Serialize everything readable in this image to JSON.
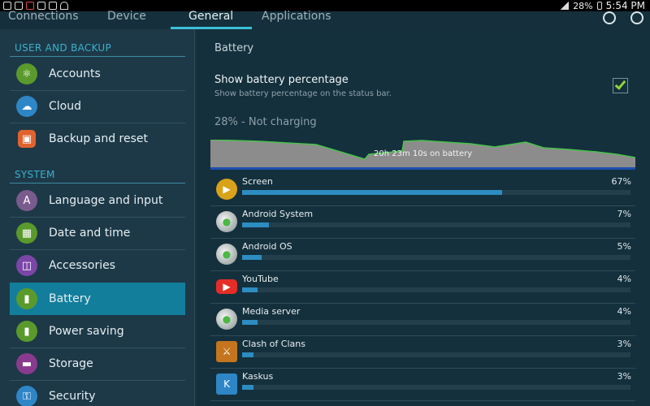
{
  "status_bar": {
    "battery_text": "28%",
    "time": "5:54 PM"
  },
  "tabs": [
    {
      "label": "Connections",
      "active": false
    },
    {
      "label": "Device",
      "active": false
    },
    {
      "label": "General",
      "active": true
    },
    {
      "label": "Applications",
      "active": false
    }
  ],
  "sidebar": {
    "sections": [
      {
        "heading": "USER AND BACKUP",
        "items": [
          {
            "label": "Accounts",
            "icon": "key-icon",
            "color": "#5a9a2c"
          },
          {
            "label": "Cloud",
            "icon": "cloud-icon",
            "color": "#2f86c7"
          },
          {
            "label": "Backup and reset",
            "icon": "backup-icon",
            "color": "#e0622e"
          }
        ]
      },
      {
        "heading": "SYSTEM",
        "items": [
          {
            "label": "Language and input",
            "icon": "language-icon",
            "color": "#7a5b8e"
          },
          {
            "label": "Date and time",
            "icon": "calendar-icon",
            "color": "#5a9a2c"
          },
          {
            "label": "Accessories",
            "icon": "accessories-icon",
            "color": "#7b46a8"
          },
          {
            "label": "Battery",
            "icon": "battery-icon",
            "color": "#5a9a2c",
            "selected": true
          },
          {
            "label": "Power saving",
            "icon": "power-saving-icon",
            "color": "#5a9a2c"
          },
          {
            "label": "Storage",
            "icon": "storage-icon",
            "color": "#8a3a8e"
          },
          {
            "label": "Security",
            "icon": "lock-icon",
            "color": "#2f86c7"
          }
        ]
      }
    ]
  },
  "main": {
    "title": "Battery",
    "option": {
      "title": "Show battery percentage",
      "subtitle": "Show battery percentage on the status bar.",
      "checked": true
    },
    "status": "28% - Not charging",
    "graph_label": "20h 23m 10s on battery",
    "usage": [
      {
        "name": "Screen",
        "pct": "67%",
        "value": 67,
        "icon": "screen-icon",
        "color": "#d8a21a"
      },
      {
        "name": "Android System",
        "pct": "7%",
        "value": 7,
        "icon": "android-icon",
        "color": "#8aa6a0"
      },
      {
        "name": "Android OS",
        "pct": "5%",
        "value": 5,
        "icon": "android-icon",
        "color": "#8aa6a0"
      },
      {
        "name": "YouTube",
        "pct": "4%",
        "value": 4,
        "icon": "youtube-icon",
        "color": "#e52d27"
      },
      {
        "name": "Media server",
        "pct": "4%",
        "value": 4,
        "icon": "android-icon",
        "color": "#8aa6a0"
      },
      {
        "name": "Clash of Clans",
        "pct": "3%",
        "value": 3,
        "icon": "clash-of-clans-icon",
        "color": "#c4751e"
      },
      {
        "name": "Kaskus",
        "pct": "3%",
        "value": 3,
        "icon": "kaskus-icon",
        "color": "#2f86c7"
      }
    ]
  }
}
